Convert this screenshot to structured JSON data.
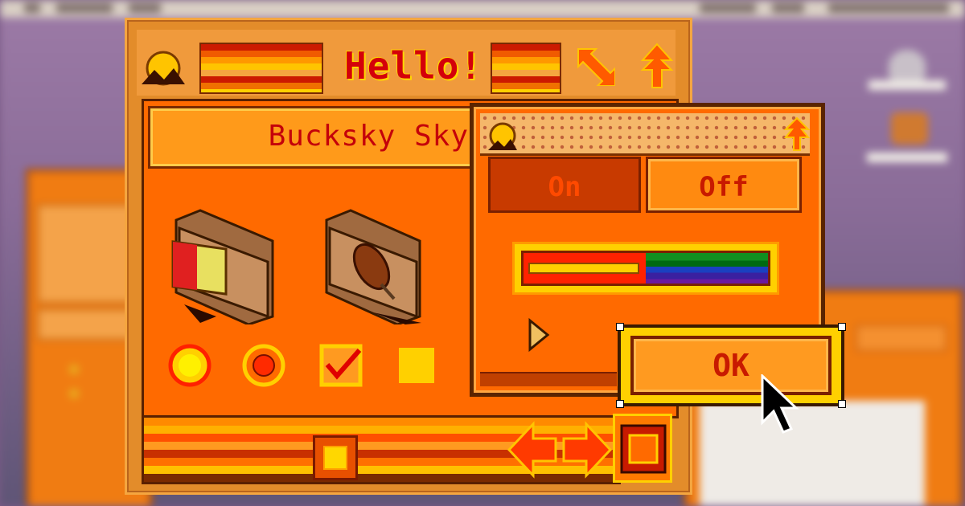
{
  "window": {
    "title": "Hello!",
    "name_field": "Bucksky Sky"
  },
  "palette": {
    "on_label": "On",
    "off_label": "Off"
  },
  "dialog": {
    "ok_label": "OK"
  },
  "controls": {
    "radio_1": "selected",
    "radio_2": "selected",
    "checkbox_1": true,
    "checkbox_2": false
  },
  "colors": {
    "accent_red": "#d4000a",
    "accent_orange": "#ff6a00",
    "accent_yellow": "#ffd000",
    "frame_brown": "#5a2000"
  },
  "icons": [
    "sun-icon",
    "resize-arrow-icon",
    "collapse-arrows-icon",
    "folder-sandwich-icon",
    "folder-popsicle-icon",
    "scroll-left-icon",
    "scroll-right-icon",
    "grow-box-icon",
    "play-icon",
    "mouse-pointer-icon"
  ]
}
